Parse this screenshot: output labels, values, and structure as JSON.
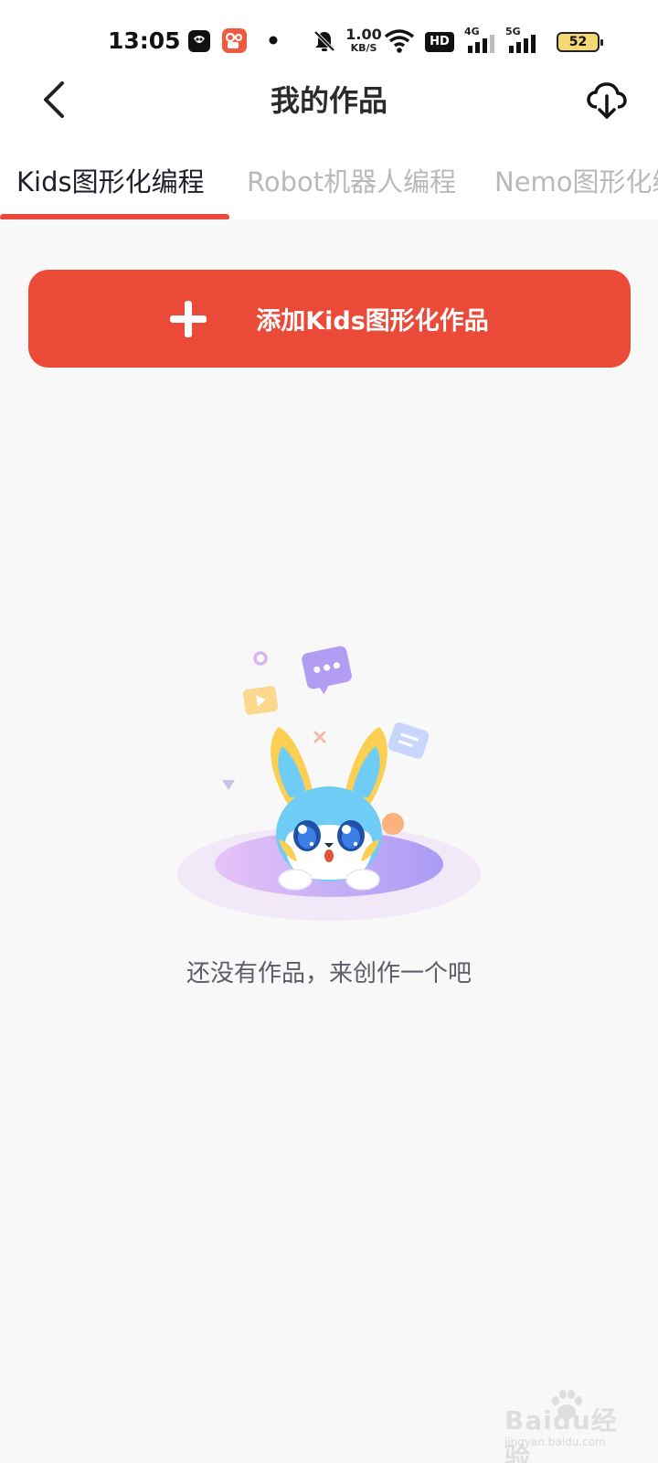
{
  "status_bar": {
    "time": "13:05",
    "net_speed_value": "1.00",
    "net_speed_unit": "KB/S",
    "battery_level": "52",
    "net_4g": "4G",
    "net_5g": "5G",
    "hd_label": "HD"
  },
  "nav": {
    "title": "我的作品"
  },
  "tabs": [
    {
      "label": "Kids图形化编程"
    },
    {
      "label": "Robot机器人编程"
    },
    {
      "label": "Nemo图形化编程"
    }
  ],
  "add_button": {
    "label": "添加Kids图形化作品"
  },
  "empty_state": {
    "message": "还没有作品，来创作一个吧"
  },
  "watermark": {
    "text": "Baidu经验",
    "url": "jingyan.baidu.com"
  },
  "colors": {
    "accent": "#ea4a37",
    "background": "#f8f8f8",
    "tab_inactive": "#b9b9b9"
  }
}
